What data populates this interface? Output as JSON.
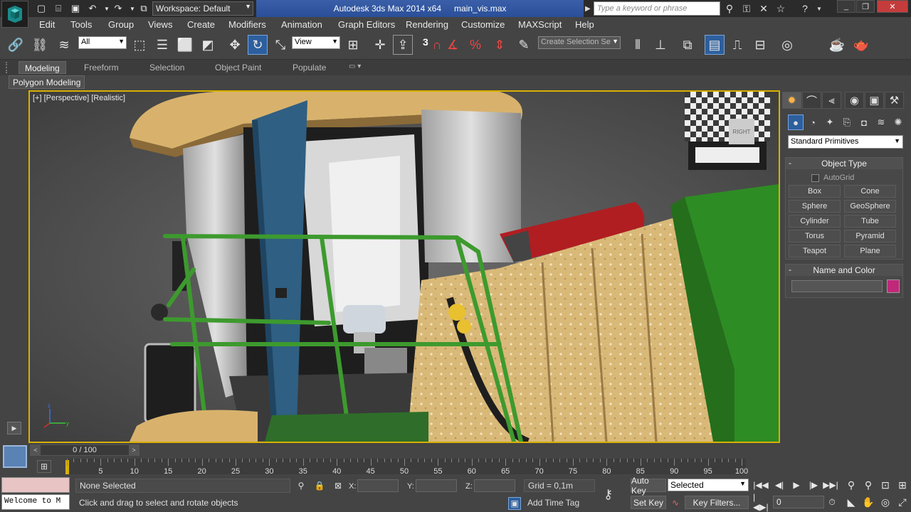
{
  "title_bar": {
    "workspace": "Workspace: Default",
    "app_title": "Autodesk 3ds Max  2014 x64",
    "file_name": "main_vis.max",
    "search_placeholder": "Type a keyword or phrase"
  },
  "menu": [
    "Edit",
    "Tools",
    "Group",
    "Views",
    "Create",
    "Modifiers",
    "Animation",
    "Graph Editors",
    "Rendering",
    "Customize",
    "MAXScript",
    "Help"
  ],
  "main_toolbar": {
    "selection_filter": "All",
    "ref_coord": "View",
    "snap_number": "3",
    "named_selection_placeholder": "Create Selection Se"
  },
  "ribbon": {
    "tabs": [
      "Modeling",
      "Freeform",
      "Selection",
      "Object Paint",
      "Populate"
    ],
    "active_tab": "Modeling",
    "panel_label": "Polygon Modeling"
  },
  "viewport": {
    "label": "[+] [Perspective] [Realistic]",
    "viewcube_label": "RIGHT"
  },
  "command_panel": {
    "category": "Standard Primitives",
    "object_type_title": "Object Type",
    "autogrid_label": "AutoGrid",
    "primitives": [
      "Box",
      "Cone",
      "Sphere",
      "GeoSphere",
      "Cylinder",
      "Tube",
      "Torus",
      "Pyramid",
      "Teapot",
      "Plane"
    ],
    "name_color_title": "Name and Color"
  },
  "timeline": {
    "frame_display": "0 / 100",
    "ticks": [
      "5",
      "10",
      "15",
      "20",
      "25",
      "30",
      "35",
      "40",
      "45",
      "50",
      "55",
      "60",
      "65",
      "70",
      "75",
      "80",
      "85",
      "90",
      "95",
      "100"
    ]
  },
  "status_bar": {
    "maxscript_text": "Welcome to M",
    "selection_info": "None Selected",
    "prompt": "Click and drag to select and rotate objects",
    "x_label": "X:",
    "y_label": "Y:",
    "z_label": "Z:",
    "grid": "Grid = 0,1m",
    "add_time_tag": "Add Time Tag",
    "auto_key": "Auto Key",
    "set_key": "Set Key",
    "key_mode": "Selected",
    "key_filters": "Key Filters...",
    "current_frame": "0"
  },
  "colors": {
    "title_accent": "#3a5fa8",
    "viewport_border": "#d8b000",
    "name_swatch": "#c0287a",
    "active_button": "#2d5f9e"
  }
}
